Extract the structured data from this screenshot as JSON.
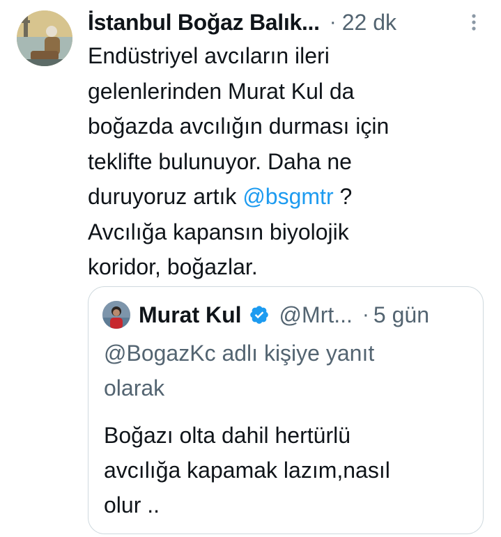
{
  "tweet": {
    "display_name": "İstanbul Boğaz Balık...",
    "separator": "·",
    "time": "22 dk",
    "more_icon": "more-vertical-icon",
    "text_lines": [
      "Endüstriyel avcıların ileri",
      "gelenlerinden Murat Kul da",
      "boğazda avcılığın durması için",
      "teklifte bulunuyor. Daha ne"
    ],
    "line5_before": "duruyoruz artık ",
    "mention": "@bsgmtr",
    "line5_after": " ?",
    "text_lines_end": [
      "Avcılığa kapansın biyolojik",
      "koridor, boğazlar."
    ]
  },
  "quote": {
    "display_name": "Murat Kul",
    "verified_icon": "verified-badge-icon",
    "handle": "@Mrt...",
    "separator": "·",
    "time": "5 gün",
    "reply_lines": [
      "@BogazKc adlı kişiye yanıt",
      "olarak"
    ],
    "text_lines": [
      "Boğazı olta dahil hertürlü",
      "avcılığa kapamak lazım,nasıl",
      "olur .."
    ]
  },
  "colors": {
    "text": "#0f1419",
    "secondary": "#536471",
    "link": "#1d9bf0",
    "border": "#cfd9de",
    "verified": "#1d9bf0"
  }
}
